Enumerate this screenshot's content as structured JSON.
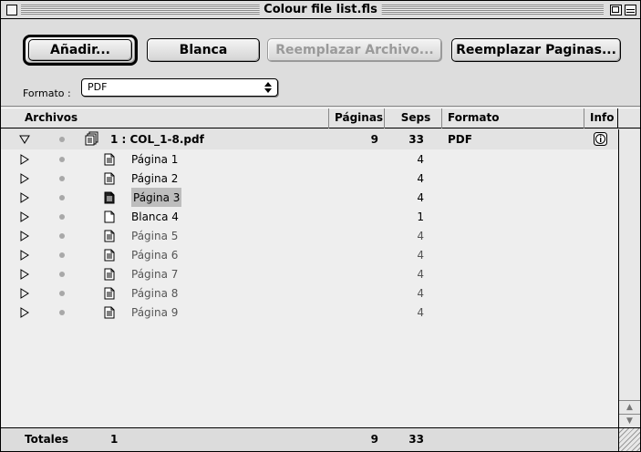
{
  "window": {
    "title": "Colour file list.fls"
  },
  "toolbar": {
    "add_label": "Añadir...",
    "blank_label": "Blanca",
    "replace_file_label": "Reemplazar Archivo...",
    "replace_pages_label": "Reemplazar Paginas..."
  },
  "format": {
    "label": "Formato :",
    "selected": "PDF",
    "arrows": "▲▼"
  },
  "columns": {
    "files": "Archivos",
    "pages": "Páginas",
    "seps": "Seps",
    "format": "Formato",
    "info": "Info"
  },
  "group": {
    "name": "1 : COL_1-8.pdf",
    "pages": "9",
    "seps": "33",
    "format": "PDF",
    "expanded": true
  },
  "rows": [
    {
      "name": "Página 1",
      "seps": "4",
      "icon": "page-icon"
    },
    {
      "name": "Página 2",
      "seps": "4",
      "icon": "page-icon"
    },
    {
      "name": "Página 3",
      "seps": "4",
      "icon": "page-icon",
      "selected": true
    },
    {
      "name": "Blanca 4",
      "seps": "1",
      "icon": "blank-page-icon"
    },
    {
      "name": "Página 5",
      "seps": "4",
      "icon": "page-icon"
    },
    {
      "name": "Página 6",
      "seps": "4",
      "icon": "page-icon"
    },
    {
      "name": "Página 7",
      "seps": "4",
      "icon": "page-icon"
    },
    {
      "name": "Página 8",
      "seps": "4",
      "icon": "page-icon"
    },
    {
      "name": "Página 9",
      "seps": "4",
      "icon": "page-icon"
    }
  ],
  "footer": {
    "label": "Totales",
    "files": "1",
    "pages": "9",
    "seps": "33"
  }
}
